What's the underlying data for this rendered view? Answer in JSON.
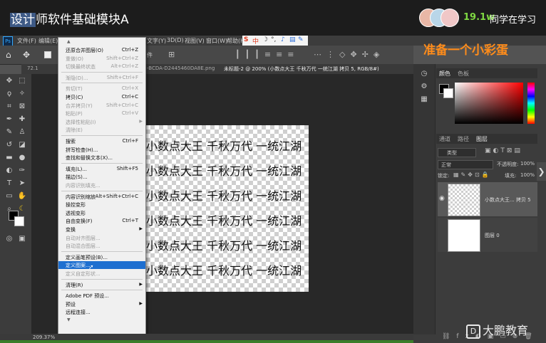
{
  "stream": {
    "course_title_hl": "设计",
    "course_title_rest": "师软件基础模块A",
    "viewer_count": "19.1w",
    "viewer_label": "同学在学习",
    "tip": "准备一个小彩蛋",
    "watermark": "大鹏教育"
  },
  "app": {
    "logo": "Ps",
    "menubar": [
      "文件(F)",
      "编辑(E)",
      "图层(L)",
      "文字(Y)",
      "选择(S)",
      "滤镜(T)",
      "3D(D)",
      "视图(V)",
      "窗口(W)",
      "帮助(H)"
    ],
    "ime": {
      "label": "中",
      "icon_s": "S"
    },
    "tabs": [
      "-BCDA-D2445460DA8E.png",
      "未标题-2 @ 200% (小数点大王  千秋万代 一统江湖 拷贝 5, RGB/8#)"
    ],
    "tab_partial": "72.1",
    "status_zoom": "209.37%"
  },
  "canvas": {
    "lines": [
      "小数点大王  千秋万代 一统江湖",
      "小数点大王  千秋万代 一统江湖",
      "小数点大王  千秋万代 一统江湖",
      "小数点大王  千秋万代 一统江湖",
      "小数点大王  千秋万代 一统江湖",
      "小数点大王  千秋万代 一统江湖"
    ]
  },
  "edit_menu": {
    "items": [
      {
        "label": "还原合并图层(O)",
        "shortcut": "Ctrl+Z",
        "disabled": false
      },
      {
        "label": "重做(O)",
        "shortcut": "Shift+Ctrl+Z",
        "disabled": true
      },
      {
        "label": "切换最终状态",
        "shortcut": "Alt+Ctrl+Z",
        "disabled": true
      },
      {
        "label": "渐隐(D)...",
        "shortcut": "Shift+Ctrl+F",
        "disabled": true
      },
      {
        "label": "剪切(T)",
        "shortcut": "Ctrl+X",
        "disabled": true
      },
      {
        "label": "拷贝(C)",
        "shortcut": "Ctrl+C",
        "disabled": false
      },
      {
        "label": "合并拷贝(Y)",
        "shortcut": "Shift+Ctrl+C",
        "disabled": true
      },
      {
        "label": "粘贴(P)",
        "shortcut": "Ctrl+V",
        "disabled": true
      },
      {
        "label": "选择性粘贴(I)",
        "shortcut": "",
        "disabled": true,
        "submenu": true
      },
      {
        "label": "清除(E)",
        "shortcut": "",
        "disabled": true
      },
      {
        "label": "搜索",
        "shortcut": "Ctrl+F",
        "disabled": false
      },
      {
        "label": "拼写检查(H)...",
        "shortcut": "",
        "disabled": false
      },
      {
        "label": "查找和替换文本(X)...",
        "shortcut": "",
        "disabled": false
      },
      {
        "label": "填充(L)...",
        "shortcut": "Shift+F5",
        "disabled": false
      },
      {
        "label": "描边(S)...",
        "shortcut": "",
        "disabled": false
      },
      {
        "label": "内容识别填充...",
        "shortcut": "",
        "disabled": true
      },
      {
        "label": "内容识别缩放",
        "shortcut": "Alt+Shift+Ctrl+C",
        "disabled": false
      },
      {
        "label": "操控变形",
        "shortcut": "",
        "disabled": false
      },
      {
        "label": "透视变形",
        "shortcut": "",
        "disabled": false
      },
      {
        "label": "自由变换(F)",
        "shortcut": "Ctrl+T",
        "disabled": false
      },
      {
        "label": "变换",
        "shortcut": "",
        "disabled": false,
        "submenu": true
      },
      {
        "label": "自动对齐图层...",
        "shortcut": "",
        "disabled": true
      },
      {
        "label": "自动混合图层...",
        "shortcut": "",
        "disabled": true
      },
      {
        "label": "定义画笔预设(B)...",
        "shortcut": "",
        "disabled": false
      },
      {
        "label": "定义图案...",
        "shortcut": "",
        "disabled": false,
        "highlighted": true
      },
      {
        "label": "定义自定形状...",
        "shortcut": "",
        "disabled": true
      },
      {
        "label": "清理(R)",
        "shortcut": "",
        "disabled": false,
        "submenu": true
      },
      {
        "label": "Adobe PDF 预设...",
        "shortcut": "",
        "disabled": false
      },
      {
        "label": "预设",
        "shortcut": "",
        "disabled": false,
        "submenu": true
      },
      {
        "label": "远程连接...",
        "shortcut": "",
        "disabled": false
      }
    ]
  },
  "panels": {
    "color_tabs": [
      "颜色",
      "色板"
    ],
    "layers_tabs": [
      "通道",
      "路径",
      "图层"
    ],
    "kind_filter": "类型",
    "blend_mode": "正常",
    "opacity_label": "不透明度:",
    "opacity_value": "100%",
    "lock_label": "锁定:",
    "fill_label": "填充:",
    "fill_value": "100%",
    "layers": [
      {
        "name": "小数点大王... 拷贝 5"
      },
      {
        "name": "图层 0"
      }
    ]
  },
  "colors": {
    "accent": "#1e6fd0",
    "tip": "#ff8c1a",
    "viewer": "#7fd842"
  }
}
